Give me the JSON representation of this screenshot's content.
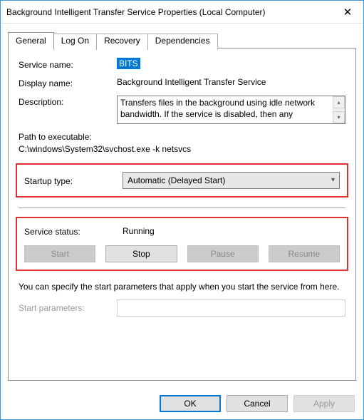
{
  "window": {
    "title": "Background Intelligent Transfer Service Properties (Local Computer)"
  },
  "tabs": {
    "general": "General",
    "logon": "Log On",
    "recovery": "Recovery",
    "dependencies": "Dependencies"
  },
  "general": {
    "service_name_label": "Service name:",
    "service_name_value": "BITS",
    "display_name_label": "Display name:",
    "display_name_value": "Background Intelligent Transfer Service",
    "description_label": "Description:",
    "description_value": "Transfers files in the background using idle network bandwidth. If the service is disabled, then any",
    "path_label": "Path to executable:",
    "path_value": "C:\\windows\\System32\\svchost.exe -k netsvcs",
    "startup_type_label": "Startup type:",
    "startup_type_value": "Automatic (Delayed Start)",
    "service_status_label": "Service status:",
    "service_status_value": "Running",
    "buttons": {
      "start": "Start",
      "stop": "Stop",
      "pause": "Pause",
      "resume": "Resume"
    },
    "help_text": "You can specify the start parameters that apply when you start the service from here.",
    "start_parameters_label": "Start parameters:",
    "start_parameters_value": ""
  },
  "footer": {
    "ok": "OK",
    "cancel": "Cancel",
    "apply": "Apply"
  }
}
